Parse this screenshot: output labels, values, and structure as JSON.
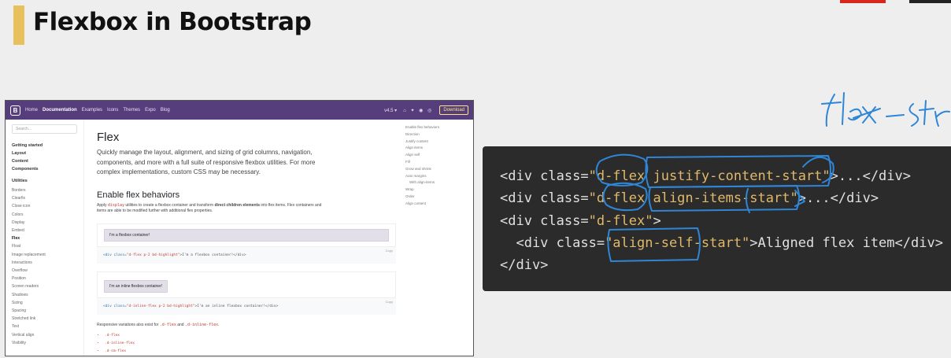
{
  "slide": {
    "title": "Flexbox in Bootstrap",
    "accent": "#e8c15c"
  },
  "handwriting": "flex-start",
  "bootstrap": {
    "nav": {
      "logo": "B",
      "links": [
        "Home",
        "Documentation",
        "Examples",
        "Icons",
        "Themes",
        "Expo",
        "Blog"
      ],
      "version": "v4.5 ▾",
      "icons": "⌂ ✦ ◉ ◎",
      "download": "Download",
      "brand": "#563d7c"
    },
    "sidebar": {
      "search_placeholder": "Search...",
      "groups": [
        "Getting started",
        "Layout",
        "Content",
        "Components",
        "Utilities"
      ],
      "utilities": [
        "Borders",
        "Clearfix",
        "Close icon",
        "Colors",
        "Display",
        "Embed",
        "Flex",
        "Float",
        "Image replacement",
        "Interactions",
        "Overflow",
        "Position",
        "Screen readers",
        "Shadows",
        "Sizing",
        "Spacing",
        "Stretched link",
        "Text",
        "Vertical align",
        "Visibility"
      ],
      "active": "Flex"
    },
    "main": {
      "title": "Flex",
      "lead": "Quickly manage the layout, alignment, and sizing of grid columns, navigation, components, and more with a full suite of responsive flexbox utilities. For more complex implementations, custom CSS may be necessary.",
      "section_title": "Enable flex behaviors",
      "section_text_1": "Apply ",
      "section_code": "display",
      "section_text_2": " utilities to create a flexbox container and transform ",
      "section_bold": "direct children elements",
      "section_text_3": " into flex items. Flex containers and items are able to be modified further with additional flex properties.",
      "example1": "I'm a flexbox container!",
      "code1_a": "<div ",
      "code1_b": "class=",
      "code1_c": "\"d-flex p-2 bd-highlight\"",
      "code1_d": ">I'm a flexbox container!</div>",
      "example2": "I'm an inline flexbox container!",
      "code2_a": "<div ",
      "code2_b": "class=",
      "code2_c": "\"d-inline-flex p-2 bd-highlight\"",
      "code2_d": ">I'm an inline flexbox container!</div>",
      "copy": "Copy",
      "resp_1": "Responsive variations also exist for ",
      "resp_code1": ".d-flex",
      "resp_2": " and ",
      "resp_code2": ".d-inline-flex",
      "resp_3": ".",
      "list": [
        ".d-flex",
        ".d-inline-flex",
        ".d-sm-flex"
      ]
    },
    "toc": [
      "Enable flex behaviors",
      "Direction",
      "Justify content",
      "Align items",
      "Align self",
      "Fill",
      "Grow and shrink",
      "Auto margins",
      "With align-items",
      "Wrap",
      "Order",
      "Align content"
    ]
  },
  "code": {
    "l1_open": "<div class=",
    "l1_str": "\"d-flex justify-content-start\"",
    "l1_close": ">...</div>",
    "l2_open": "<div class=",
    "l2_str": "\"d-flex align-items-start\"",
    "l2_close": ">...</div>",
    "l3_open": "<div class=",
    "l3_str": "\"d-flex\"",
    "l3_close": ">",
    "l4_open": "  <div class=",
    "l4_str": "\"align-self-start\"",
    "l4_close": ">Aligned flex item</div>",
    "l5": "</div>"
  }
}
